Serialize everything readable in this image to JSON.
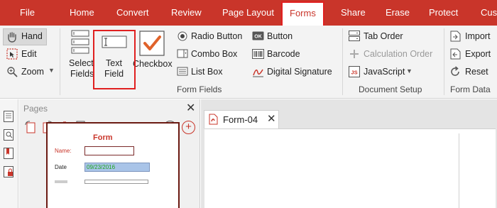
{
  "menu": {
    "items": [
      "File",
      "Home",
      "Convert",
      "Review",
      "Page Layout",
      "Forms",
      "Share",
      "Erase",
      "Protect",
      "Cust"
    ],
    "active": "Forms"
  },
  "ribbon": {
    "tools": {
      "hand": "Hand",
      "edit": "Edit",
      "zoom": "Zoom"
    },
    "select_fields": [
      "Select",
      "Fields"
    ],
    "text_field": [
      "Text",
      "Field"
    ],
    "checkbox": "Checkbox",
    "radio_button": "Radio Button",
    "combo_box": "Combo Box",
    "list_box": "List Box",
    "button": "Button",
    "barcode": "Barcode",
    "digital_signature": "Digital Signature",
    "form_fields_group": "Form Fields",
    "tab_order": "Tab Order",
    "calculation_order": "Calculation Order",
    "javascript": "JavaScript",
    "document_setup_group": "Document Setup",
    "import": "Import",
    "export": "Export",
    "reset": "Reset",
    "form_data_group": "Form Data"
  },
  "pages_panel": {
    "title": "Pages",
    "thumbnail": {
      "form_title": "Form",
      "name_label": "Name:",
      "date_label": "Date",
      "date_value": "09/23/2016"
    }
  },
  "document": {
    "tab_label": "Form-04"
  },
  "colors": {
    "brand": "#c9352a",
    "highlight": "#e02020",
    "ribbon_bg": "#f3f3f3"
  },
  "icons": [
    "hand-icon",
    "edit-icon",
    "zoom-icon",
    "select-fields-icon",
    "text-field-icon",
    "checkbox-icon",
    "radio-button-icon",
    "combo-box-icon",
    "list-box-icon",
    "button-icon",
    "barcode-icon",
    "digital-signature-icon",
    "tab-order-icon",
    "calculation-order-icon",
    "javascript-icon",
    "import-icon",
    "export-icon",
    "reset-icon",
    "close-icon",
    "pdf-file-icon"
  ]
}
